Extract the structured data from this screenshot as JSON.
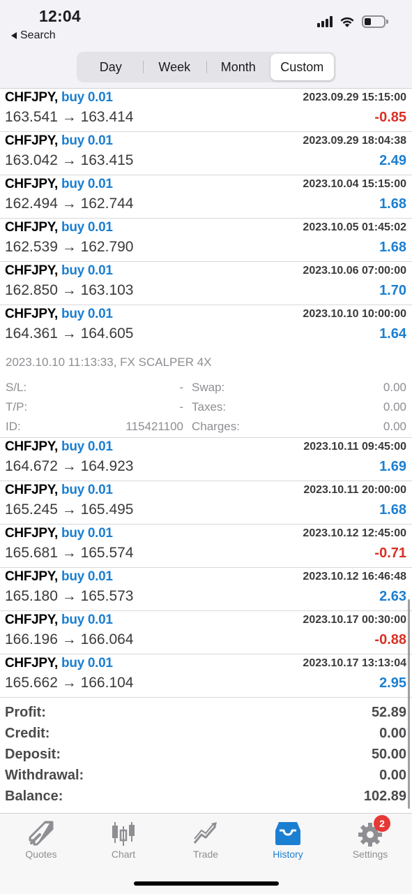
{
  "status_bar": {
    "time": "12:04",
    "back_label": "Search"
  },
  "segments": [
    {
      "label": "Day",
      "active": false
    },
    {
      "label": "Week",
      "active": false
    },
    {
      "label": "Month",
      "active": false
    },
    {
      "label": "Custom",
      "active": true
    }
  ],
  "trades": [
    {
      "symbol": "CHFJPY,",
      "side": "buy 0.01",
      "prices": "163.541 → 163.414",
      "time": "2023.09.29 15:15:00",
      "profit": "-0.85"
    },
    {
      "symbol": "CHFJPY,",
      "side": "buy 0.01",
      "prices": "163.042 → 163.415",
      "time": "2023.09.29 18:04:38",
      "profit": "2.49"
    },
    {
      "symbol": "CHFJPY,",
      "side": "buy 0.01",
      "prices": "162.494 → 162.744",
      "time": "2023.10.04 15:15:00",
      "profit": "1.68"
    },
    {
      "symbol": "CHFJPY,",
      "side": "buy 0.01",
      "prices": "162.539 → 162.790",
      "time": "2023.10.05 01:45:02",
      "profit": "1.68"
    },
    {
      "symbol": "CHFJPY,",
      "side": "buy 0.01",
      "prices": "162.850 → 163.103",
      "time": "2023.10.06 07:00:00",
      "profit": "1.70"
    },
    {
      "symbol": "CHFJPY,",
      "side": "buy 0.01",
      "prices": "164.361 → 164.605",
      "time": "2023.10.10 10:00:00",
      "profit": "1.64"
    },
    {
      "symbol": "CHFJPY,",
      "side": "buy 0.01",
      "prices": "164.672 → 164.923",
      "time": "2023.10.11 09:45:00",
      "profit": "1.69"
    },
    {
      "symbol": "CHFJPY,",
      "side": "buy 0.01",
      "prices": "165.245 → 165.495",
      "time": "2023.10.11 20:00:00",
      "profit": "1.68"
    },
    {
      "symbol": "CHFJPY,",
      "side": "buy 0.01",
      "prices": "165.681 → 165.574",
      "time": "2023.10.12 12:45:00",
      "profit": "-0.71"
    },
    {
      "symbol": "CHFJPY,",
      "side": "buy 0.01",
      "prices": "165.180 → 165.573",
      "time": "2023.10.12 16:46:48",
      "profit": "2.63"
    },
    {
      "symbol": "CHFJPY,",
      "side": "buy 0.01",
      "prices": "166.196 → 166.064",
      "time": "2023.10.17 00:30:00",
      "profit": "-0.88"
    },
    {
      "symbol": "CHFJPY,",
      "side": "buy 0.01",
      "prices": "165.662 → 166.104",
      "time": "2023.10.17 13:13:04",
      "profit": "2.95"
    }
  ],
  "detail": {
    "comment": "2023.10.10 11:13:33, FX SCALPER 4X",
    "sl_label": "S/L:",
    "sl_value": "-",
    "tp_label": "T/P:",
    "tp_value": "-",
    "id_label": "ID:",
    "id_value": "115421100",
    "swap_label": "Swap:",
    "swap_value": "0.00",
    "taxes_label": "Taxes:",
    "taxes_value": "0.00",
    "charges_label": "Charges:",
    "charges_value": "0.00"
  },
  "summary": [
    {
      "label": "Profit:",
      "value": "52.89"
    },
    {
      "label": "Credit:",
      "value": "0.00"
    },
    {
      "label": "Deposit:",
      "value": "50.00"
    },
    {
      "label": "Withdrawal:",
      "value": "0.00"
    },
    {
      "label": "Balance:",
      "value": "102.89"
    }
  ],
  "tabs": [
    {
      "label": "Quotes",
      "icon": "quotes-icon"
    },
    {
      "label": "Chart",
      "icon": "chart-icon"
    },
    {
      "label": "Trade",
      "icon": "trade-icon"
    },
    {
      "label": "History",
      "icon": "history-icon",
      "active": true
    },
    {
      "label": "Settings",
      "icon": "settings-icon",
      "badge": "2"
    }
  ],
  "colors": {
    "accent": "#1b7fd1",
    "loss": "#d93025",
    "badge": "#e53935"
  }
}
